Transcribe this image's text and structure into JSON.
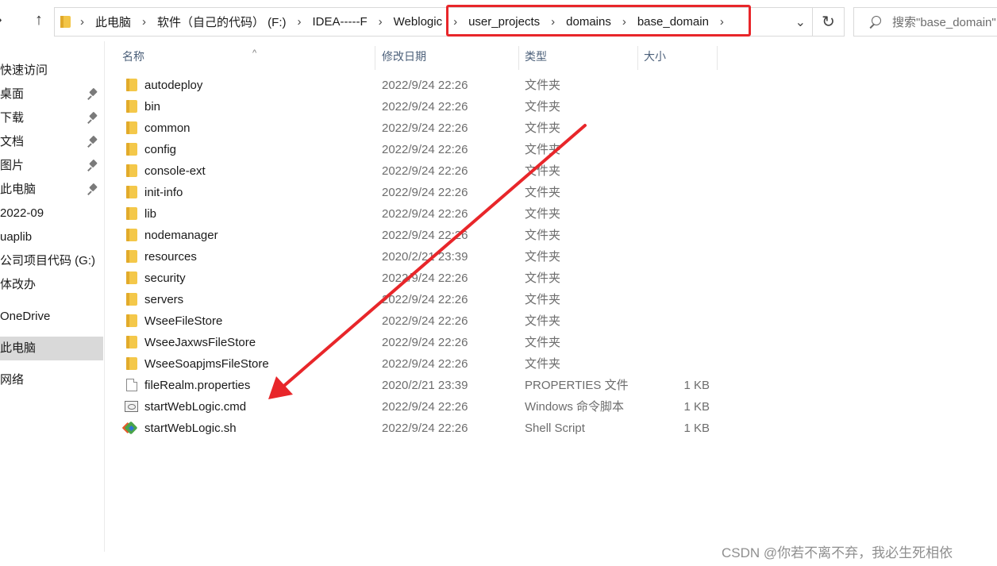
{
  "nav": {
    "up_arrow": "↑",
    "back_arrow": "›"
  },
  "address": {
    "breadcrumbs": [
      "此电脑",
      "软件（自己的代码） (F:)",
      "IDEA-----F",
      "Weblogic",
      "user_projects",
      "domains",
      "base_domain"
    ],
    "separator": "›",
    "dropdown_glyph": "⌄",
    "refresh_glyph": "↻"
  },
  "search": {
    "placeholder": "搜索\"base_domain\""
  },
  "sidebar": {
    "items": [
      {
        "label": "快速访问",
        "pinned": false
      },
      {
        "label": "桌面",
        "pinned": true
      },
      {
        "label": "下载",
        "pinned": true
      },
      {
        "label": "文档",
        "pinned": true
      },
      {
        "label": "图片",
        "pinned": true
      },
      {
        "label": "此电脑",
        "pinned": true
      },
      {
        "label": "2022-09",
        "pinned": false
      },
      {
        "label": "uaplib",
        "pinned": false
      },
      {
        "label": "公司项目代码 (G:)",
        "pinned": false
      },
      {
        "label": "体改办",
        "pinned": false
      },
      {
        "label": "OneDrive",
        "pinned": false
      },
      {
        "label": "此电脑",
        "pinned": false
      },
      {
        "label": "网络",
        "pinned": false
      }
    ],
    "selected_index": 11
  },
  "columns": {
    "name": "名称",
    "date": "修改日期",
    "type": "类型",
    "size": "大小"
  },
  "files": [
    {
      "name": "autodeploy",
      "date": "2022/9/24 22:26",
      "type": "文件夹",
      "size": "",
      "kind": "folder"
    },
    {
      "name": "bin",
      "date": "2022/9/24 22:26",
      "type": "文件夹",
      "size": "",
      "kind": "folder"
    },
    {
      "name": "common",
      "date": "2022/9/24 22:26",
      "type": "文件夹",
      "size": "",
      "kind": "folder"
    },
    {
      "name": "config",
      "date": "2022/9/24 22:26",
      "type": "文件夹",
      "size": "",
      "kind": "folder"
    },
    {
      "name": "console-ext",
      "date": "2022/9/24 22:26",
      "type": "文件夹",
      "size": "",
      "kind": "folder"
    },
    {
      "name": "init-info",
      "date": "2022/9/24 22:26",
      "type": "文件夹",
      "size": "",
      "kind": "folder"
    },
    {
      "name": "lib",
      "date": "2022/9/24 22:26",
      "type": "文件夹",
      "size": "",
      "kind": "folder"
    },
    {
      "name": "nodemanager",
      "date": "2022/9/24 22:26",
      "type": "文件夹",
      "size": "",
      "kind": "folder"
    },
    {
      "name": "resources",
      "date": "2020/2/21 23:39",
      "type": "文件夹",
      "size": "",
      "kind": "folder"
    },
    {
      "name": "security",
      "date": "2022/9/24 22:26",
      "type": "文件夹",
      "size": "",
      "kind": "folder"
    },
    {
      "name": "servers",
      "date": "2022/9/24 22:26",
      "type": "文件夹",
      "size": "",
      "kind": "folder"
    },
    {
      "name": "WseeFileStore",
      "date": "2022/9/24 22:26",
      "type": "文件夹",
      "size": "",
      "kind": "folder"
    },
    {
      "name": "WseeJaxwsFileStore",
      "date": "2022/9/24 22:26",
      "type": "文件夹",
      "size": "",
      "kind": "folder"
    },
    {
      "name": "WseeSoapjmsFileStore",
      "date": "2022/9/24 22:26",
      "type": "文件夹",
      "size": "",
      "kind": "folder"
    },
    {
      "name": "fileRealm.properties",
      "date": "2020/2/21 23:39",
      "type": "PROPERTIES 文件",
      "size": "1 KB",
      "kind": "doc"
    },
    {
      "name": "startWebLogic.cmd",
      "date": "2022/9/24 22:26",
      "type": "Windows 命令脚本",
      "size": "1 KB",
      "kind": "cmd"
    },
    {
      "name": "startWebLogic.sh",
      "date": "2022/9/24 22:26",
      "type": "Shell Script",
      "size": "1 KB",
      "kind": "sh"
    }
  ],
  "annotation": {
    "color": "#e8262a"
  },
  "watermark": "CSDN @你若不离不弃，我必生死相依"
}
